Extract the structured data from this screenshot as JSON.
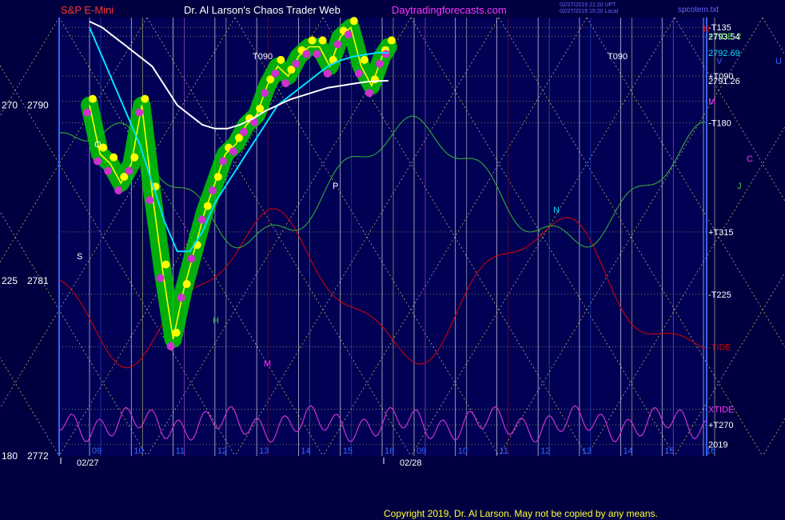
{
  "header": {
    "symbol": "S&P E-Mini",
    "title": "Dr. Al Larson's Chaos Trader Web",
    "site": "Daytradingforecasts.com",
    "stamp_line1": "02/27/2019 21:20 UPT",
    "stamp_line2": "02/27/2019 15:20 Local",
    "filename": "spcotem.txt"
  },
  "footer": {
    "copyright": "Copyright 2019, Dr. Al Larson. May not be copied by any means."
  },
  "colors": {
    "background": "#000040",
    "plot_bg": "#000055",
    "price": "#ffff00",
    "band": "#00cc00",
    "ema_fast": "#00e0ff",
    "ema_slow": "#ffffff",
    "tide_neg": "#cc0000",
    "tide_pos": "#33aa33",
    "xtide": "#cc33cc",
    "grid": "#cccc66"
  },
  "chart_data": {
    "type": "line",
    "title": "S&P E-Mini",
    "xlabel": "",
    "ylabel": "",
    "ylim": [
      2772,
      2794.5
    ],
    "left_axis_labels": [
      {
        "angle": "270",
        "price": "2790",
        "value": 2790
      },
      {
        "angle": "225",
        "price": "2781",
        "value": 2781
      },
      {
        "angle": "180",
        "price": "2772",
        "value": 2772
      }
    ],
    "right_price_labels": [
      {
        "text": "2793.54",
        "value": 2793.54,
        "color": "#ffffff"
      },
      {
        "text": "2792.69",
        "value": 2792.69,
        "color": "#00e0ff"
      },
      {
        "text": "2791.26",
        "value": 2791.26,
        "color": "#ffffff"
      }
    ],
    "right_level_labels": [
      {
        "text": "-T135",
        "value": 2794.0,
        "color": "#ffffff"
      },
      {
        "text": "+TIDE-2",
        "value": 2793.55,
        "color": "#33dd33"
      },
      {
        "text": "+T090",
        "value": 2791.5,
        "color": "#ffffff"
      },
      {
        "text": "M",
        "value": 2790.2,
        "color": "#ff33ff"
      },
      {
        "text": "-T180",
        "value": 2789.1,
        "color": "#ffffff"
      },
      {
        "text": "+T315",
        "value": 2783.5,
        "color": "#ffffff"
      },
      {
        "text": "-T225",
        "value": 2780.3,
        "color": "#ffffff"
      },
      {
        "text": "-TIDE",
        "value": 2777.6,
        "color": "#cc0000"
      },
      {
        "text": "XTIDE",
        "value": 2774.4,
        "color": "#ff33ff"
      },
      {
        "text": "+T270",
        "value": 2773.6,
        "color": "#ffffff"
      },
      {
        "text": "2019",
        "value": 2772.6,
        "color": "#ffffff"
      }
    ],
    "dates": [
      "02/27",
      "02/28"
    ],
    "hour_ticks_day1": [
      "09",
      "10",
      "11",
      "12",
      "13",
      "14",
      "15",
      "16"
    ],
    "hour_ticks_day2": [
      "09",
      "10",
      "11",
      "12",
      "13",
      "14",
      "15",
      "16"
    ],
    "annotations": [
      "T090",
      "T090",
      "O",
      "P",
      "S",
      "H",
      "M",
      "N",
      "J",
      "U",
      "V",
      "C",
      "R"
    ],
    "series": [
      {
        "name": "",
        "color": "#ffff00",
        "x": [
          9.0,
          9.25,
          9.5,
          9.75,
          10.0,
          10.25,
          10.5,
          10.75,
          11.0,
          11.25,
          11.5,
          11.75,
          12.0,
          12.25,
          12.5,
          12.75,
          13.0,
          13.25,
          13.5,
          13.75,
          14.0,
          14.25,
          14.5,
          14.75,
          15.0,
          15.25,
          15.5,
          15.75,
          16.0,
          16.15
        ],
        "values": [
          2790.0,
          2787.5,
          2787.0,
          2786.0,
          2787.0,
          2790.0,
          2785.5,
          2781.5,
          2778.0,
          2780.5,
          2782.5,
          2784.5,
          2786.0,
          2787.5,
          2788.0,
          2789.0,
          2789.5,
          2791.0,
          2792.0,
          2791.5,
          2792.5,
          2793.0,
          2793.0,
          2792.0,
          2793.5,
          2794.0,
          2792.0,
          2791.0,
          2792.5,
          2793.0
        ]
      },
      {
        "name": "",
        "color": "#00e0ff",
        "x": [
          9.0,
          9.3,
          9.6,
          9.9,
          10.2,
          10.5,
          10.8,
          11.1,
          11.4,
          11.7,
          12.0,
          12.3,
          12.6,
          12.9,
          13.2,
          13.5,
          13.8,
          14.1,
          14.4,
          14.7,
          15.0,
          15.3,
          15.6,
          15.9,
          16.15
        ],
        "values": [
          2794.0,
          2792.5,
          2791.0,
          2789.5,
          2788.0,
          2786.0,
          2784.0,
          2782.5,
          2782.5,
          2783.5,
          2785.0,
          2786.0,
          2787.0,
          2788.0,
          2789.0,
          2790.0,
          2790.5,
          2791.0,
          2791.5,
          2792.0,
          2792.3,
          2792.5,
          2792.6,
          2792.7,
          2792.69
        ]
      },
      {
        "name": "",
        "color": "#ffffff",
        "x": [
          9.0,
          9.3,
          9.6,
          9.9,
          10.2,
          10.5,
          10.8,
          11.1,
          11.4,
          11.7,
          12.0,
          12.3,
          12.6,
          12.9,
          13.2,
          13.5,
          13.8,
          14.1,
          14.4,
          14.7,
          15.0,
          15.3,
          15.6,
          15.9,
          16.15
        ],
        "values": [
          2794.3,
          2794.0,
          2793.5,
          2793.0,
          2792.5,
          2792.0,
          2791.0,
          2790.0,
          2789.5,
          2789.0,
          2788.8,
          2788.8,
          2789.0,
          2789.3,
          2789.7,
          2790.0,
          2790.3,
          2790.5,
          2790.7,
          2790.9,
          2791.0,
          2791.1,
          2791.2,
          2791.25,
          2791.26
        ]
      }
    ],
    "grid": true,
    "legend": "none"
  }
}
